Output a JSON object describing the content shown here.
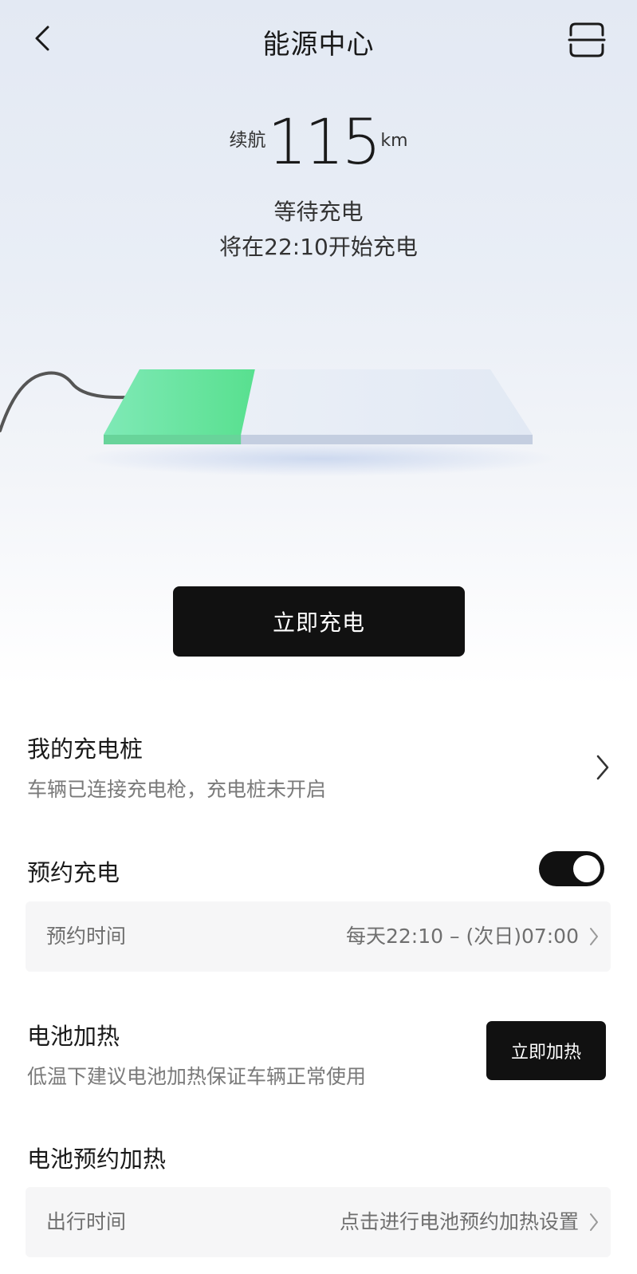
{
  "header": {
    "title": "能源中心",
    "back_icon": "chevron-left-icon",
    "scan_icon": "scan-icon"
  },
  "range": {
    "label": "续航",
    "value": "115",
    "unit": "km"
  },
  "status": {
    "state": "等待充电",
    "detail": "将在22:10开始充电"
  },
  "battery": {
    "level_fraction": 0.32,
    "fill_color": "#6ee7a6"
  },
  "actions": {
    "charge_now": "立即充电"
  },
  "charger": {
    "title": "我的充电桩",
    "subtitle": "车辆已连接充电枪，充电桩未开启"
  },
  "scheduled_charging": {
    "title": "预约充电",
    "enabled": true,
    "row_label": "预约时间",
    "row_value": "每天22:10 – (次日)07:00"
  },
  "battery_heating": {
    "title": "电池加热",
    "subtitle": "低温下建议电池加热保证车辆正常使用",
    "button": "立即加热"
  },
  "scheduled_heating": {
    "title": "电池预约加热",
    "row_label": "出行时间",
    "row_value": "点击进行电池预约加热设置"
  },
  "colors": {
    "accent_dark": "#111111",
    "text_secondary": "#7a7a7a",
    "hero_bg": "#e3e9f3"
  }
}
